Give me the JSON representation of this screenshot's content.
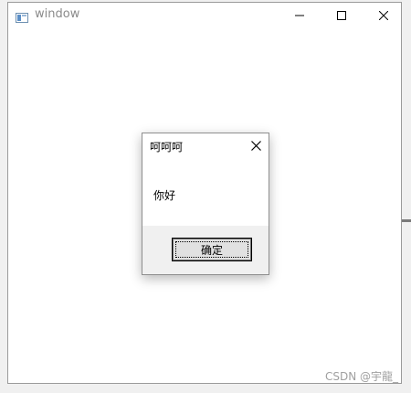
{
  "window": {
    "title": "window",
    "controls": [
      "minimize-icon",
      "maximize-icon",
      "close-icon"
    ]
  },
  "dialog": {
    "title": "呵呵呵",
    "message": "你好",
    "ok_label": "确定",
    "close_icon": "close-icon"
  },
  "watermark": {
    "text": "CSDN @宇龍_"
  },
  "colors": {
    "window_bg": "#ffffff",
    "dialog_footer_bg": "#f0f0f0",
    "button_bg": "#e1e1e1",
    "title_text": "#8a8a8a"
  }
}
